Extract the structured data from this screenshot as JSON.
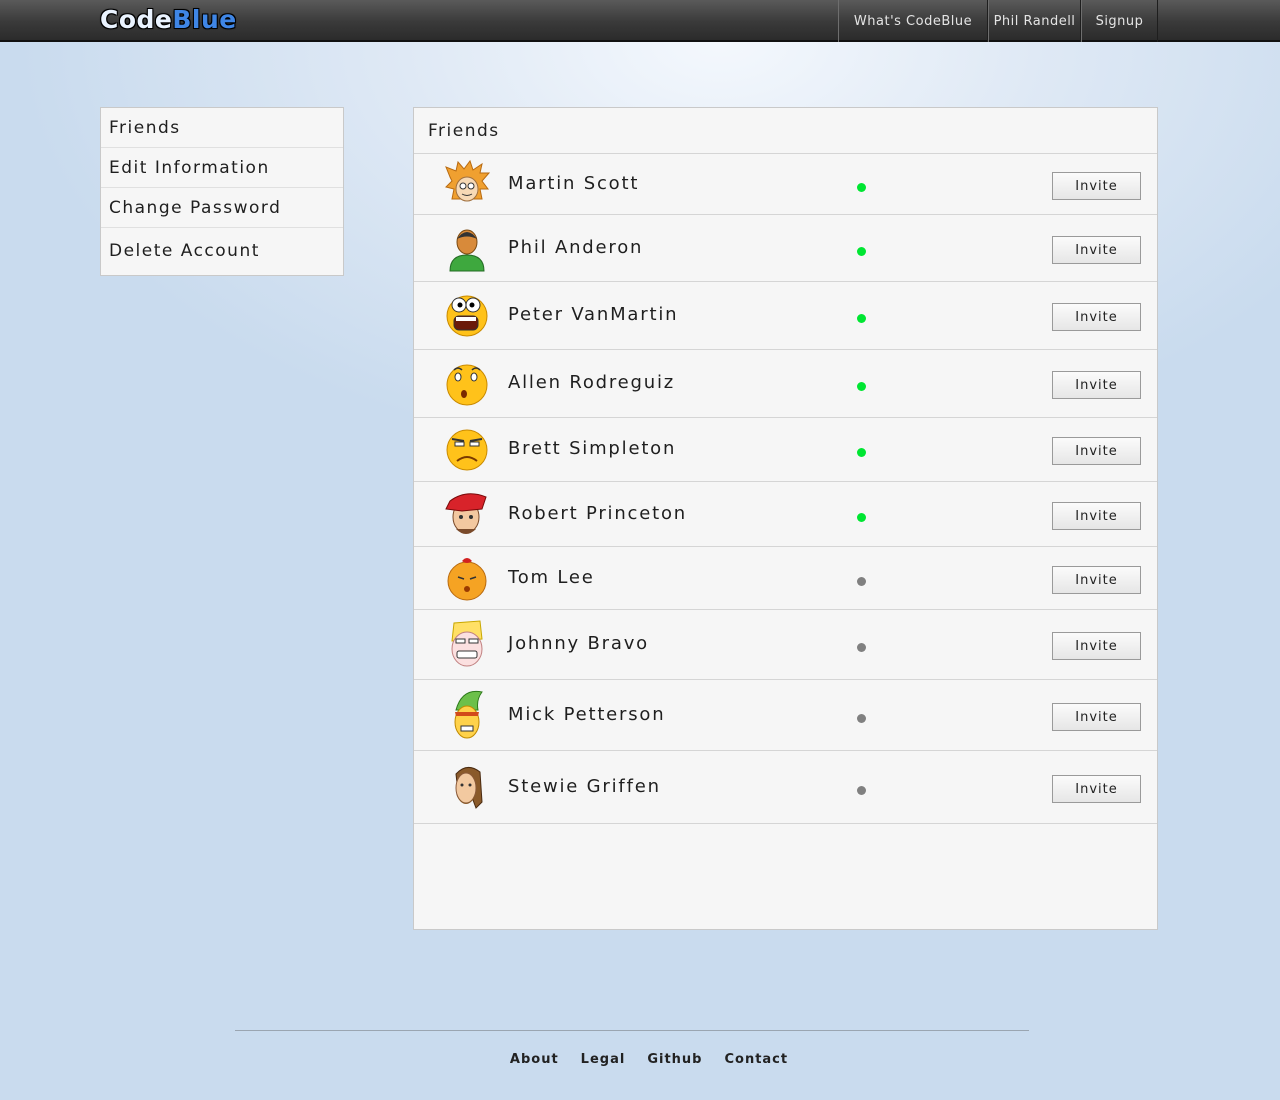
{
  "header": {
    "logo_part1": "Code",
    "logo_part2": "Blue",
    "nav": [
      "What's CodeBlue",
      "Phil Randell",
      "Signup"
    ]
  },
  "sidebar": {
    "items": [
      "Friends",
      "Edit Information",
      "Change Password",
      "Delete Account"
    ]
  },
  "main": {
    "title": "Friends",
    "invite_label": "Invite",
    "friends": [
      {
        "name": "Martin Scott",
        "status": "online",
        "avatar": "spiky-hair-cartoon-avatar-icon"
      },
      {
        "name": "Phil Anderon",
        "status": "online",
        "avatar": "person-silhouette-avatar-icon"
      },
      {
        "name": "Peter VanMartin",
        "status": "online",
        "avatar": "shocked-smiley-avatar-icon"
      },
      {
        "name": "Allen Rodreguiz",
        "status": "online",
        "avatar": "surprised-smiley-avatar-icon"
      },
      {
        "name": "Brett Simpleton",
        "status": "online",
        "avatar": "annoyed-smiley-avatar-icon"
      },
      {
        "name": "Robert Princeton",
        "status": "online",
        "avatar": "red-cap-cartoon-avatar-icon"
      },
      {
        "name": "Tom Lee",
        "status": "offline",
        "avatar": "orange-face-avatar-icon"
      },
      {
        "name": "Johnny Bravo",
        "status": "offline",
        "avatar": "blond-grinning-avatar-icon"
      },
      {
        "name": "Mick Petterson",
        "status": "offline",
        "avatar": "green-hat-cartoon-avatar-icon"
      },
      {
        "name": "Stewie Griffen",
        "status": "offline",
        "avatar": "bearded-man-avatar-icon"
      }
    ]
  },
  "colors": {
    "online": "#00e632",
    "offline": "#808080",
    "logo_blue": "#3f86e6"
  },
  "footer": {
    "links": [
      "About",
      "Legal",
      "Github",
      "Contact"
    ]
  }
}
